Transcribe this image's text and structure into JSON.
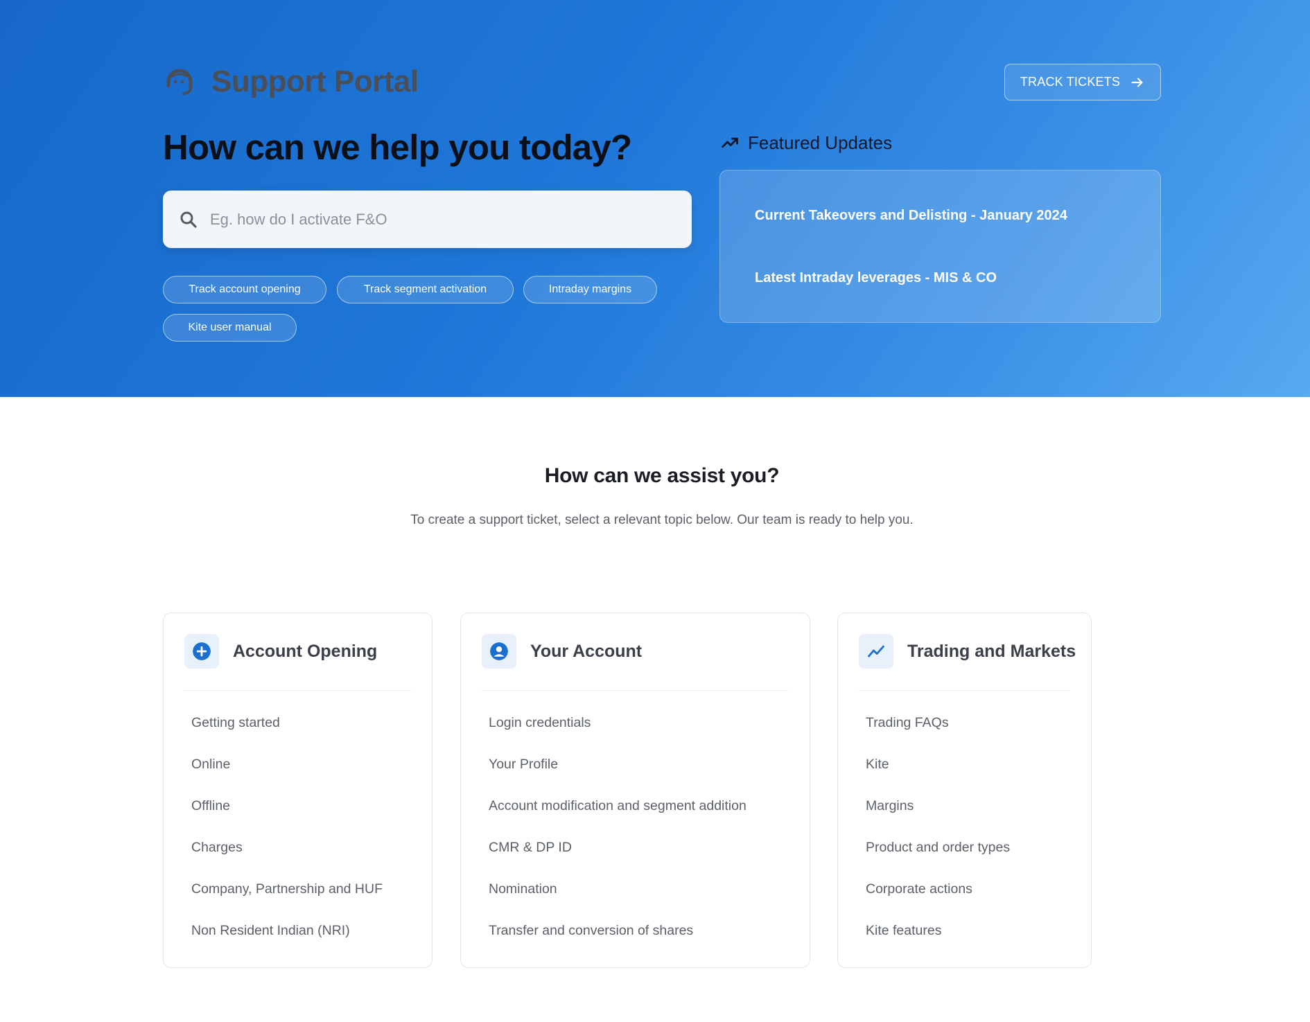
{
  "header": {
    "brand_title": "Support Portal",
    "brand_icon": "headset-icon",
    "track_tickets_label": "TRACK TICKETS",
    "track_tickets_icon": "arrow-right-icon"
  },
  "hero": {
    "heading": "How can we help you today?",
    "search": {
      "placeholder": "Eg. how do I activate F&O",
      "value": "",
      "icon": "search-icon"
    },
    "quick_links": [
      "Track account opening",
      "Track segment activation",
      "Intraday margins",
      "Kite user manual"
    ]
  },
  "featured": {
    "title": "Featured Updates",
    "icon": "trending-up-icon",
    "items": [
      "Current Takeovers and Delisting - January 2024",
      "Latest Intraday leverages - MIS & CO"
    ]
  },
  "assist": {
    "title": "How can we assist you?",
    "subtitle": "To create a support ticket, select a relevant topic below. Our team is ready to help you."
  },
  "categories": [
    {
      "title": "Account Opening",
      "icon": "plus-circle-icon",
      "items": [
        "Getting started",
        "Online",
        "Offline",
        "Charges",
        "Company, Partnership and HUF",
        "Non Resident Indian (NRI)"
      ]
    },
    {
      "title": "Your Account",
      "icon": "user-circle-icon",
      "items": [
        "Login credentials",
        "Your Profile",
        "Account modification and segment addition",
        "CMR & DP ID",
        "Nomination",
        "Transfer and conversion of shares"
      ]
    },
    {
      "title": "Trading and Markets",
      "icon": "trend-chart-icon",
      "items": [
        "Trading FAQs",
        "Kite",
        "Margins",
        "Product and order types",
        "Corporate actions",
        "Kite features"
      ]
    }
  ],
  "colors": {
    "hero_gradient_start": "#1768c8",
    "hero_gradient_end": "#56aaf0",
    "accent": "#1a6fd0",
    "card_icon_bg": "#e8f0fa"
  }
}
